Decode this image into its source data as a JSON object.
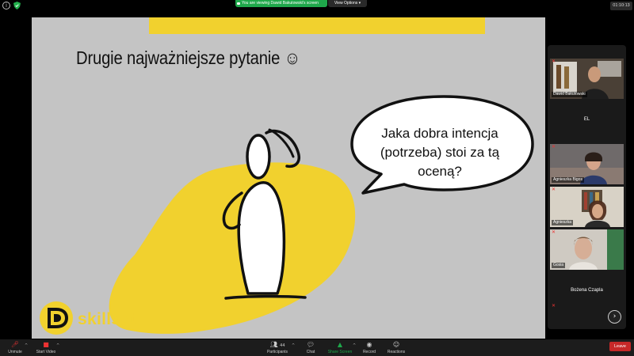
{
  "topbar": {
    "share_notice": "You are viewing Dawid Bakutowski's screen",
    "view_options": "View Options",
    "timer": "01:10:13"
  },
  "slide": {
    "title": "Drugie najważniejsze pytanie ☺",
    "bubble_lines": [
      "Jaka dobra intencja",
      "(potrzeba) stoi za tą",
      "oceną?"
    ],
    "brand": "skillset",
    "colors": {
      "yellow": "#f1d12e",
      "background": "#c4c4c4"
    }
  },
  "participants": [
    {
      "name": "Dawid Bakutowski",
      "video": true
    },
    {
      "name": "EL",
      "video": false
    },
    {
      "name": "Agnieszka Bigos",
      "video": true
    },
    {
      "name": "Agnieszka",
      "video": true
    },
    {
      "name": "Gosia",
      "video": true
    },
    {
      "name": "Bożena Czapla",
      "video": false
    }
  ],
  "toolbar": {
    "unmute": "Unmute",
    "start_video": "Start Video",
    "participants_label": "Participants",
    "participants_count": "44",
    "chat": "Chat",
    "share_screen": "Share Screen",
    "record": "Record",
    "reactions": "Reactions",
    "leave": "Leave"
  }
}
